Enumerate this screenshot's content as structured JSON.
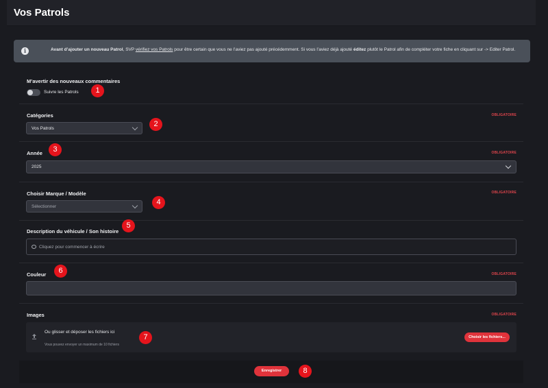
{
  "page": {
    "title": "Vos Patrols"
  },
  "banner": {
    "bold_lead": "Avant d’ajouter un nouveau Patrol",
    "text_1": ", SVP ",
    "link": "vérifiez vos Patrols",
    "text_2": " pour être certain que vous ne l’aviez pas ajouté précédemment. Si vous l’aviez déjà ajouté ",
    "bold_edit": "éditez",
    "text_3": " plutôt le Patrol afin de compléter votre fiche en cliquant sur -> Editer Patrol."
  },
  "required_label": "OBLIGATOIRE",
  "notify": {
    "label": "M’avertir des nouveaux commentaires",
    "toggle_label": "Suivre les Patrols",
    "enabled": false
  },
  "categories": {
    "label": "Catégories",
    "value": "Vos Patrols"
  },
  "year": {
    "label": "Année",
    "value": "2025"
  },
  "model": {
    "label": "Choisir Marque / Modèle",
    "placeholder": "Sélectionner"
  },
  "description": {
    "label": "Description du véhicule / Son histoire",
    "placeholder": "Cliquez pour commencer à écrire"
  },
  "color": {
    "label": "Couleur",
    "value": ""
  },
  "images": {
    "label": "Images",
    "drop_title": "Ou glisser et déposer les fichiers ici",
    "drop_sub": "Vous pouvez envoyer un maximum de 10 fichiers",
    "choose_button": "Choisir les fichiers..."
  },
  "save_button": "Enregistrer",
  "markers": [
    "1",
    "2",
    "3",
    "4",
    "5",
    "6",
    "7",
    "8"
  ],
  "colors": {
    "accent": "#e0333b",
    "marker": "#e5141c",
    "background": "#1a1b20"
  }
}
